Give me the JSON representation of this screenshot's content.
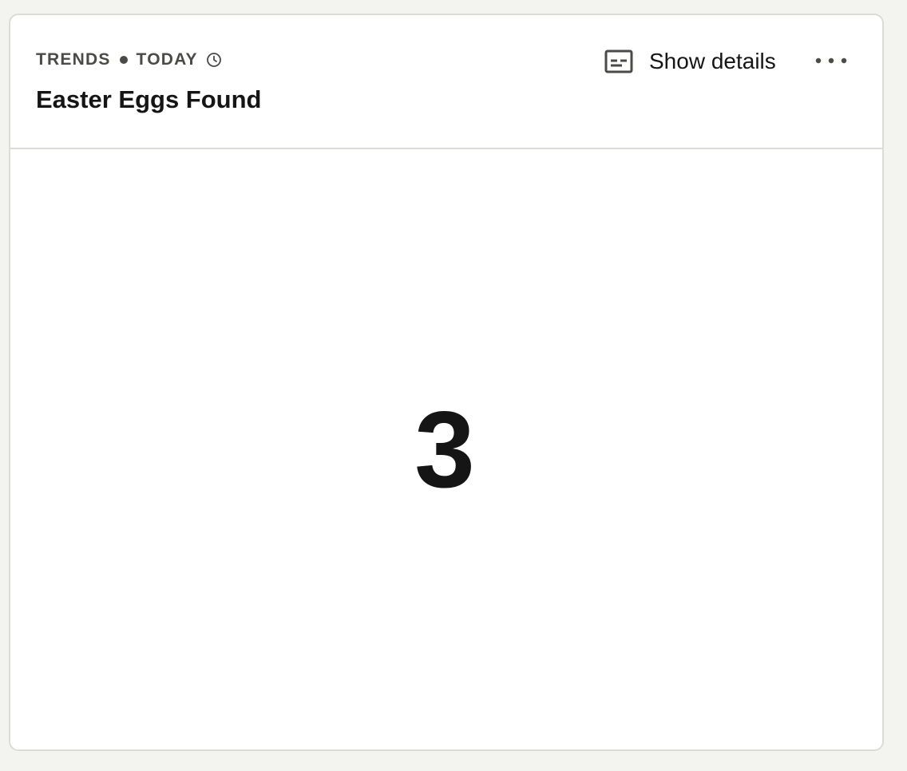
{
  "card": {
    "meta": {
      "type": "TRENDS",
      "range": "TODAY",
      "clock_icon": "clock-icon"
    },
    "title": "Easter Eggs Found",
    "actions": {
      "details_icon": "details-panel-icon",
      "details_label": "Show details",
      "more_icon": "more-dots-icon"
    },
    "value": "3"
  },
  "colors": {
    "background": "#f3f3ef",
    "card": "#ffffff",
    "border": "#dcdcd6",
    "text": "#151515",
    "muted_text": "#4a4a47"
  }
}
